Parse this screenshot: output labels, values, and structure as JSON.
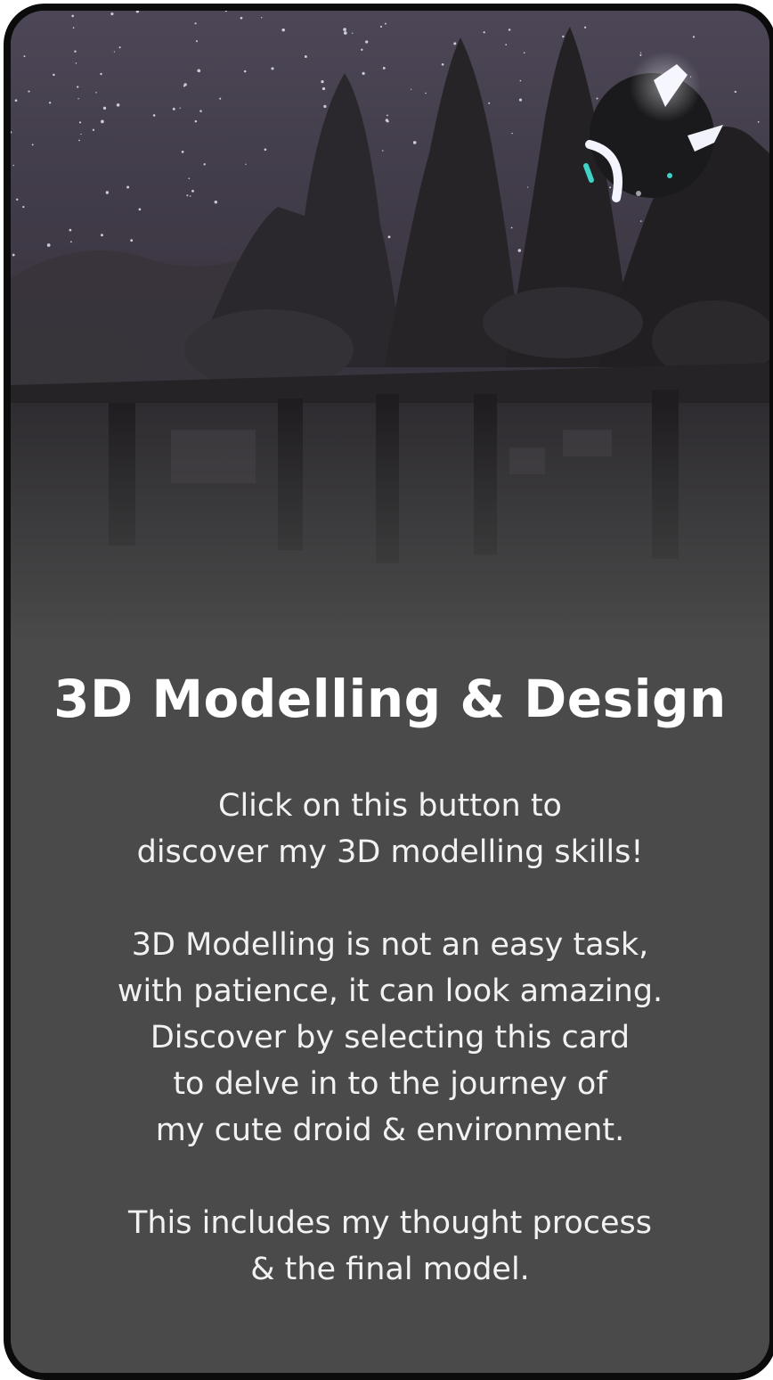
{
  "card": {
    "title": "3D Modelling & Design",
    "paragraphs": [
      [
        "Click on this button to",
        "discover my 3D modelling skills!"
      ],
      [
        "3D Modelling is not an easy task,",
        "with patience, it can look amazing.",
        "Discover by selecting this card",
        "to delve in to the journey of",
        "my cute droid & environment."
      ],
      [
        "This includes my thought process",
        "& the final model."
      ]
    ]
  },
  "colors": {
    "card_background": "#4a4a4a",
    "border": "#0b0b0b",
    "text": "#f2f2f2",
    "droid_glow": "#e8e8ff",
    "droid_accent": "#3fd3c6"
  }
}
